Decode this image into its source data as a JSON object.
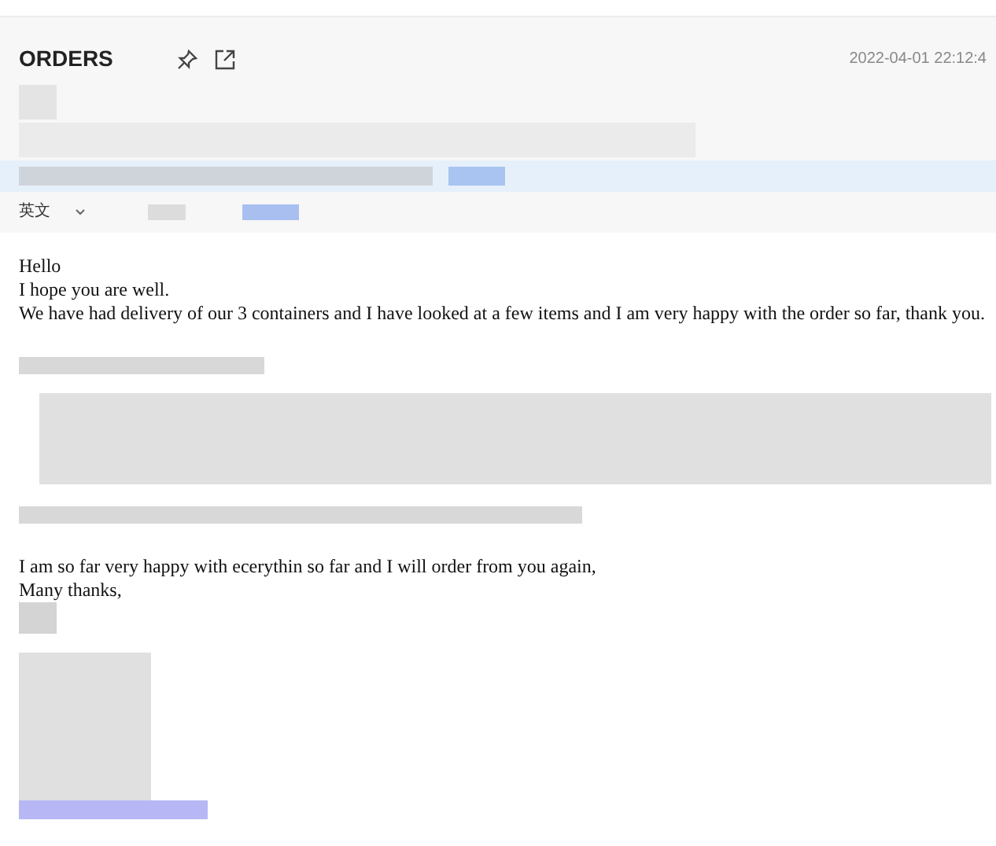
{
  "header": {
    "subject": "ORDERS",
    "timestamp": "2022-04-01 22:12:4",
    "language": "英文"
  },
  "body": {
    "greeting": [
      "Hello",
      "I hope you are well.",
      "We have had delivery of our 3 containers and I have looked at a few items and I am very happy with the order so far, thank you."
    ],
    "closing": [
      "I am so far very happy with ecerythin so far and I will order from you again,",
      "Many thanks,"
    ]
  }
}
